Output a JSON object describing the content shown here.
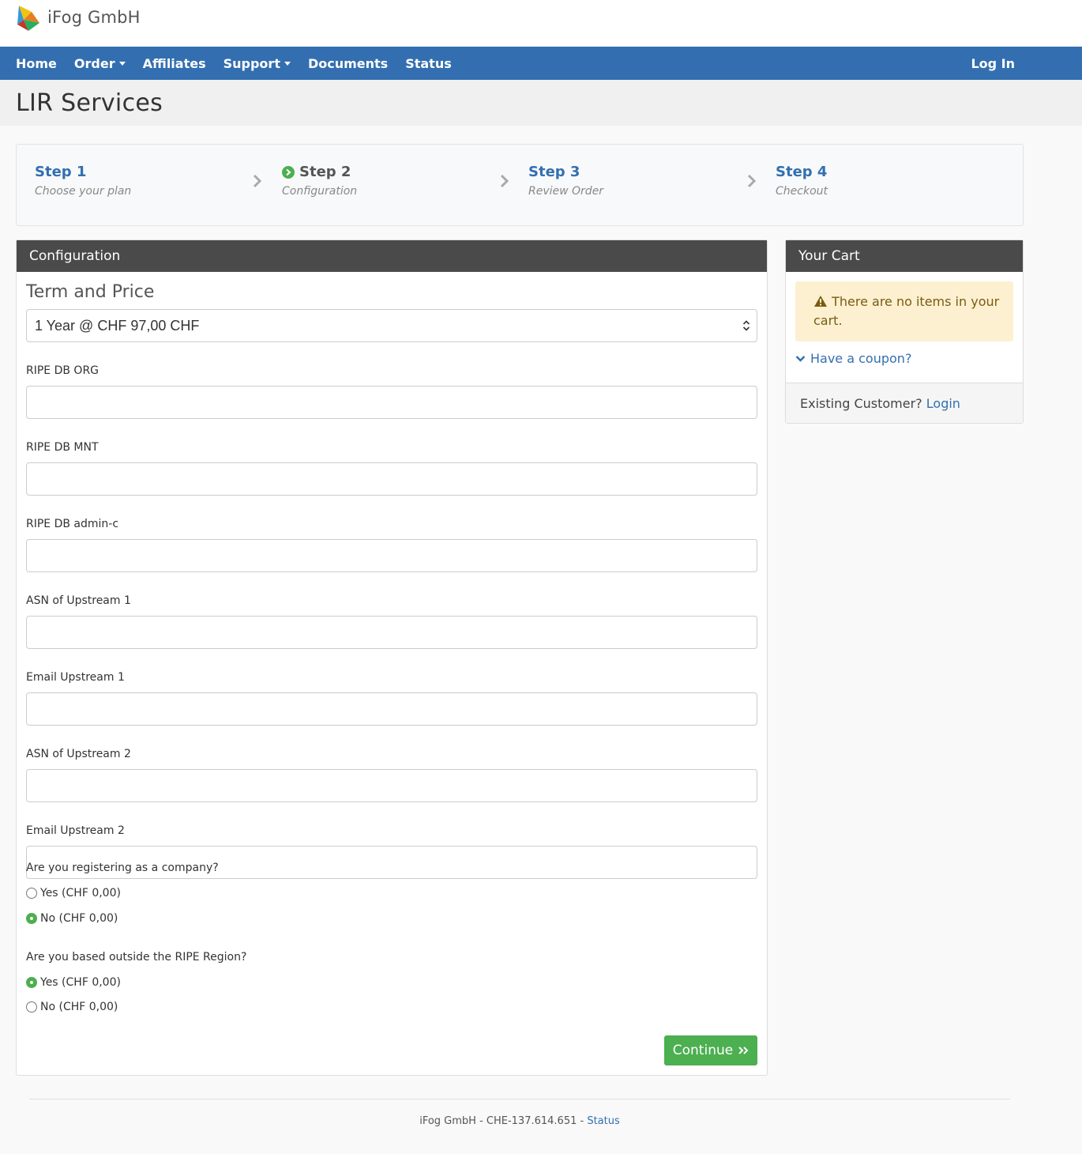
{
  "brand": {
    "name": "iFog GmbH"
  },
  "nav": {
    "items": [
      {
        "label": "Home"
      },
      {
        "label": "Order",
        "dropdown": true
      },
      {
        "label": "Affiliates"
      },
      {
        "label": "Support",
        "dropdown": true
      },
      {
        "label": "Documents"
      },
      {
        "label": "Status"
      }
    ],
    "login": "Log In"
  },
  "page": {
    "title": "LIR Services"
  },
  "steps": [
    {
      "title": "Step 1",
      "subtitle": "Choose your plan"
    },
    {
      "title": "Step 2",
      "subtitle": "Configuration",
      "active": true
    },
    {
      "title": "Step 3",
      "subtitle": "Review Order"
    },
    {
      "title": "Step 4",
      "subtitle": "Checkout"
    }
  ],
  "configuration": {
    "heading": "Configuration",
    "term_title": "Term and Price",
    "term_selected": "1 Year @ CHF 97,00 CHF",
    "fields": [
      {
        "label": "RIPE DB ORG",
        "value": ""
      },
      {
        "label": "RIPE DB MNT",
        "value": ""
      },
      {
        "label": "RIPE DB admin-c",
        "value": ""
      },
      {
        "label": "ASN of Upstream 1",
        "value": ""
      },
      {
        "label": "Email Upstream 1",
        "value": ""
      },
      {
        "label": "ASN of Upstream 2",
        "value": ""
      },
      {
        "label": "Email Upstream 2",
        "value": ""
      }
    ],
    "questions": [
      {
        "label": "Are you registering as a company?",
        "options": [
          {
            "label": "Yes (CHF 0,00)",
            "selected": false
          },
          {
            "label": "No (CHF 0,00)",
            "selected": true
          }
        ]
      },
      {
        "label": "Are you based outside the RIPE Region?",
        "options": [
          {
            "label": "Yes (CHF 0,00)",
            "selected": true
          },
          {
            "label": "No (CHF 0,00)",
            "selected": false
          }
        ]
      }
    ],
    "continue_label": "Continue"
  },
  "cart": {
    "heading": "Your Cart",
    "empty_message": "There are no items in your cart.",
    "coupon_label": "Have a coupon?",
    "existing_text": "Existing Customer?",
    "login_link": "Login"
  },
  "footer": {
    "text": "iFog GmbH - CHE-137.614.651 - ",
    "status_link": "Status"
  },
  "colors": {
    "primary": "#336fb0",
    "success": "#4caf50",
    "panel_header": "#4a4a4a",
    "alert_bg": "#fcf0d0"
  }
}
